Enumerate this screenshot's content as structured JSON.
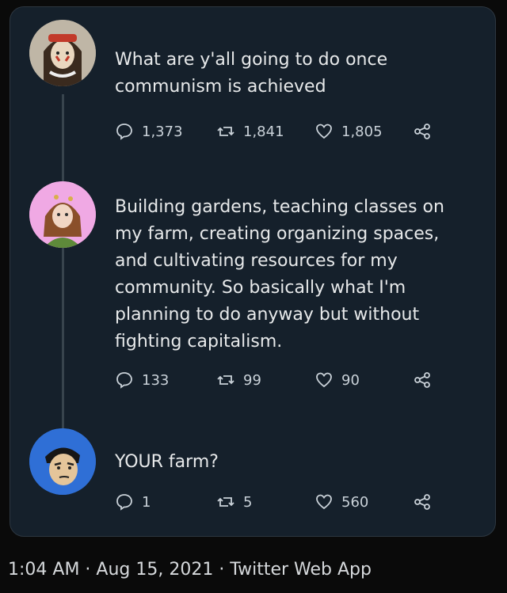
{
  "tweets": [
    {
      "text": "What are y'all going to do once\ncommunism is achieved",
      "replies": "1,373",
      "retweets": "1,841",
      "likes": "1,805"
    },
    {
      "text": "Building gardens, teaching classes on\nmy farm,  creating organizing spaces,\nand cultivating resources for my\ncommunity. So basically what I'm\nplanning to do anyway but without\nfighting capitalism.",
      "replies": "133",
      "retweets": "99",
      "likes": "90"
    },
    {
      "text": "YOUR farm?",
      "replies": "1",
      "retweets": "5",
      "likes": "560"
    }
  ],
  "footer": {
    "meta": "1:04 AM · Aug 15, 2021 · Twitter Web App"
  },
  "icons": {
    "reply": "reply-icon",
    "retweet": "retweet-icon",
    "like": "heart-icon",
    "share": "share-icon"
  },
  "colors": {
    "background": "#0a0a0a",
    "card": "#15202b",
    "text": "#e7e9ea",
    "muted": "#c9d1d8",
    "thread_line": "#38444d"
  }
}
